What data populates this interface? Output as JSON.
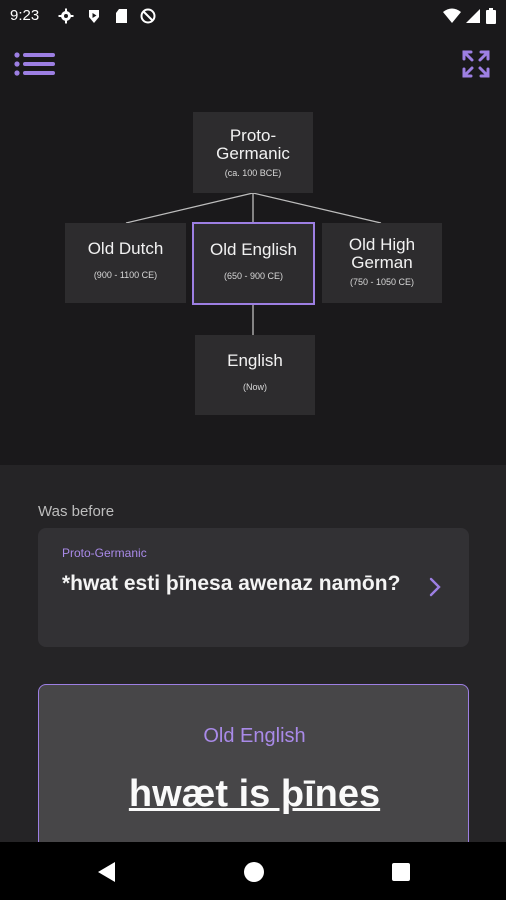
{
  "status_bar": {
    "time": "9:23",
    "icons_left": [
      "gear-icon",
      "play-icon",
      "sd-card-icon",
      "no-sync-icon"
    ],
    "icons_right": [
      "wifi-icon",
      "signal-icon",
      "battery-icon"
    ]
  },
  "app_bar": {
    "menu_icon": "list-menu-icon",
    "expand_icon": "expand-arrows-icon",
    "accent": "#9d7fe3"
  },
  "tree": {
    "root": {
      "name_line1": "Proto-",
      "name_line2": "Germanic",
      "date": "(ca. 100 BCE)"
    },
    "children": [
      {
        "name_line1": "Old Dutch",
        "name_line2": "",
        "date": "(900 - 1100 CE)"
      },
      {
        "name_line1": "Old English",
        "name_line2": "",
        "date": "(650 - 900 CE)",
        "selected": true
      },
      {
        "name_line1": "Old High",
        "name_line2": "German",
        "date": "(750 - 1050 CE)"
      }
    ],
    "leaf": {
      "name_line1": "English",
      "name_line2": "",
      "date": "(Now)"
    }
  },
  "was_before": {
    "heading": "Was before",
    "language": "Proto-Germanic",
    "phrase": "*hwat esti þīnesa awenaz namōn?"
  },
  "current": {
    "language": "Old English",
    "phrase": "hwæt is þīnes"
  },
  "nav_bar": {
    "back": "back-triangle-icon",
    "home": "home-circle-icon",
    "recents": "recents-square-icon"
  }
}
